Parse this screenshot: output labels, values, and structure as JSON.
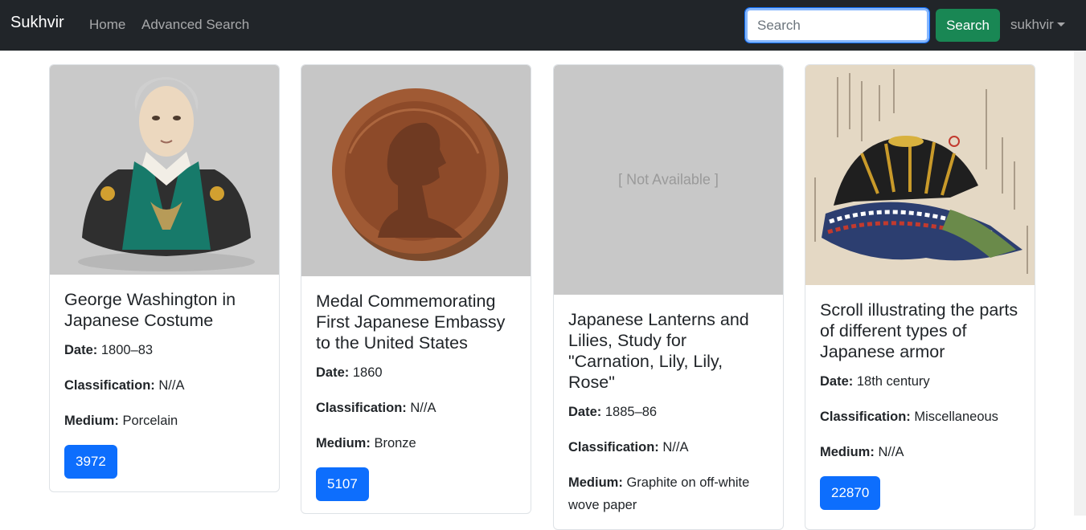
{
  "navbar": {
    "brand": "Sukhvir",
    "links": [
      "Home",
      "Advanced Search"
    ],
    "search_placeholder": "Search",
    "search_button": "Search",
    "user": "sukhvir"
  },
  "cards": [
    {
      "title": "George Washington in Japanese Costume",
      "date_label": "Date:",
      "date": "1800–83",
      "classification_label": "Classification:",
      "classification": "N//A",
      "medium_label": "Medium:",
      "medium": "Porcelain",
      "object_id": "3972",
      "image": "porcelain bust of George Washington"
    },
    {
      "title": "Medal Commemorating First Japanese Embassy to the United States",
      "date_label": "Date:",
      "date": "1860",
      "classification_label": "Classification:",
      "classification": "N//A",
      "medium_label": "Medium:",
      "medium": "Bronze",
      "object_id": "5107",
      "image": "bronze medal"
    },
    {
      "title": "Japanese Lanterns and Lilies, Study for \"Carnation, Lily, Lily, Rose\"",
      "date_label": "Date:",
      "date": "1885–86",
      "classification_label": "Classification:",
      "classification": "N//A",
      "medium_label": "Medium:",
      "medium": "Graphite on off-white wove paper",
      "object_id": "",
      "image_placeholder": "[ Not Available ]"
    },
    {
      "title": "Scroll illustrating the parts of different types of Japanese armor",
      "date_label": "Date:",
      "date": "18th century",
      "classification_label": "Classification:",
      "classification": "Miscellaneous",
      "medium_label": "Medium:",
      "medium": "N//A",
      "object_id": "22870",
      "image": "armor scroll illustration"
    }
  ]
}
